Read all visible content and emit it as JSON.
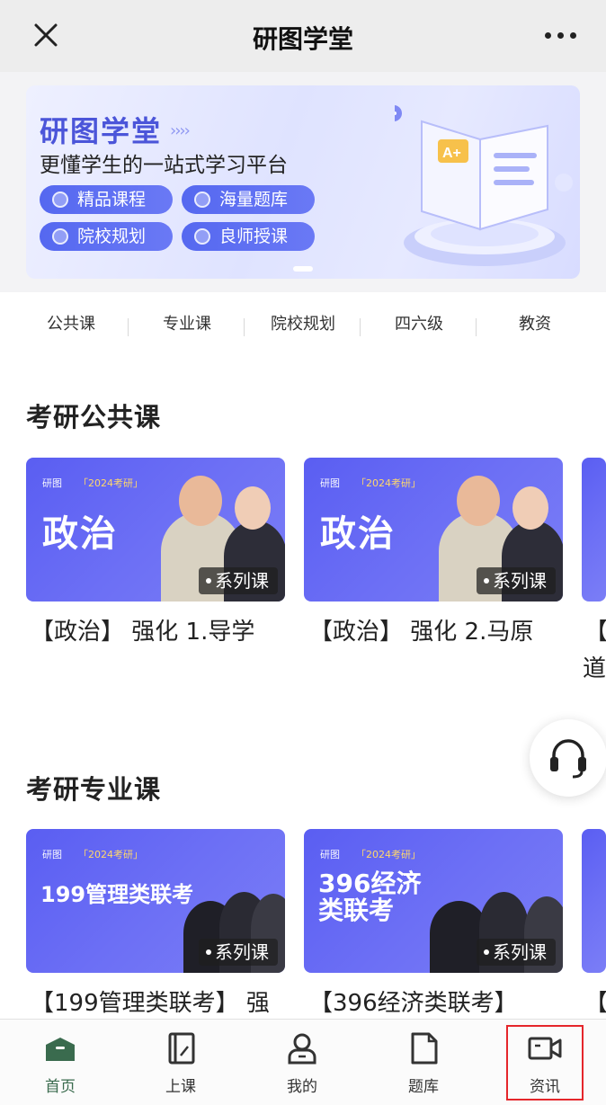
{
  "window": {
    "title": "研图学堂"
  },
  "banner": {
    "title": "研图学堂",
    "subtitle": "更懂学生的一站式学习平台",
    "pills": [
      "精品课程",
      "海量题库",
      "院校规划",
      "良师授课"
    ]
  },
  "categories": [
    "公共课",
    "专业课",
    "院校规划",
    "四六级",
    "教资"
  ],
  "public_section": {
    "title": "考研公共课",
    "cards": [
      {
        "brand": "研图",
        "year": "「2024考研」",
        "subject": "政治",
        "badge": "系列课",
        "caption": "【政治】 强化 1.导学"
      },
      {
        "brand": "研图",
        "year": "「2024考研」",
        "subject": "政治",
        "badge": "系列课",
        "caption": "【政治】 强化 2.马原"
      }
    ],
    "partial_caption_top": "【",
    "partial_caption_bottom": "道"
  },
  "major_section": {
    "title": "考研专业课",
    "cards": [
      {
        "brand": "研图",
        "year": "「2024考研」",
        "subject": "199管理类联考",
        "badge": "系列课",
        "caption": "【199管理类联考】 强"
      },
      {
        "brand": "研图",
        "year": "「2024考研」",
        "subject": "396经济类联考",
        "badge": "系列课",
        "caption": "【396经济类联考】"
      }
    ],
    "partial_caption": "【"
  },
  "tabbar": {
    "items": [
      {
        "label": "首页",
        "icon": "home-icon",
        "active": true
      },
      {
        "label": "上课",
        "icon": "notebook-icon",
        "active": false
      },
      {
        "label": "我的",
        "icon": "person-icon",
        "active": false
      },
      {
        "label": "题库",
        "icon": "document-icon",
        "active": false
      },
      {
        "label": "资讯",
        "icon": "video-icon",
        "active": false
      }
    ]
  },
  "colors": {
    "accent": "#3a6b4e",
    "card": "#5a5ef2",
    "banner_title": "#4b55d9",
    "highlight": "#e5262b"
  }
}
